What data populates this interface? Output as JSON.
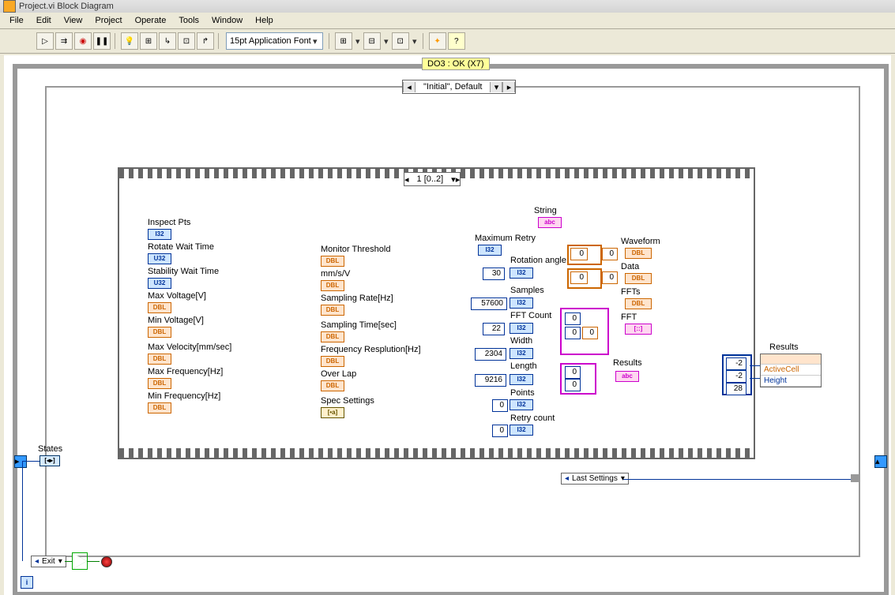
{
  "window": {
    "title": "Project.vi Block Diagram"
  },
  "menu": {
    "file": "File",
    "edit": "Edit",
    "view": "View",
    "project": "Project",
    "operate": "Operate",
    "tools": "Tools",
    "window": "Window",
    "help": "Help"
  },
  "toolbar": {
    "font": "15pt Application Font"
  },
  "case_outer": {
    "label": "DO3 : OK (X7)",
    "sel": "\"Initial\", Default"
  },
  "seq": {
    "sel": "1 [0..2]"
  },
  "col1": {
    "inspect": "Inspect Pts",
    "rotate": "Rotate Wait Time",
    "stability": "Stability Wait Time",
    "maxv": "Max Voltage[V]",
    "minv": "Min Voltage[V]",
    "maxvel": "Max Velocity[mm/sec]",
    "maxf": "Max Frequency[Hz]",
    "minf": "Min Frequency[Hz]",
    "t_i32": "I32",
    "t_u32": "U32",
    "t_dbl": "DBL"
  },
  "col2": {
    "mon": "Monitor Threshold",
    "mms": "mm/s/V",
    "samp": "Sampling Rate[Hz]",
    "stime": "Sampling Time[sec]",
    "freq": "Frequency Resplution[Hz]",
    "over": "Over Lap",
    "spec": "Spec Settings",
    "t_dbl": "DBL"
  },
  "col3": {
    "string": "String",
    "t_abc": "abc",
    "maxretry": "Maximum Retry",
    "rotangle": "Rotation angle",
    "samples": "Samples",
    "fftcount": "FFT Count",
    "width": "Width",
    "length": "Length",
    "points": "Points",
    "retrycnt": "Retry count",
    "t_i32": "I32"
  },
  "consts": {
    "c30": "30",
    "c57600": "57600",
    "c22": "22",
    "c2304": "2304",
    "c9216": "9216",
    "c0a": "0",
    "c0b": "0",
    "c0c": "0",
    "c0d": "0",
    "c0e": "0",
    "c0f": "0",
    "c0g": "0"
  },
  "col4": {
    "waveform": "Waveform",
    "data": "Data",
    "ffts": "FFTs",
    "fft": "FFT",
    "results": "Results",
    "t_dbl": "DBL",
    "t_abc": "abc"
  },
  "right": {
    "results": "Results",
    "active": "ActiveCell",
    "height": "Height",
    "m2": "-2",
    "m2b": "-2",
    "v28": "28"
  },
  "bottom": {
    "states": "States",
    "last": "Last Settings",
    "exit": "Exit"
  },
  "icons": {
    "run": "▷",
    "runc": "⇉",
    "abort": "◉",
    "pause": "❚❚",
    "bulb": "💡",
    "retain": "⊞",
    "step1": "↳",
    "step2": "⊡",
    "step3": "↱",
    "align": "⊞",
    "dist": "⊟",
    "order": "⊡",
    "clean": "✦",
    "help": "?"
  }
}
